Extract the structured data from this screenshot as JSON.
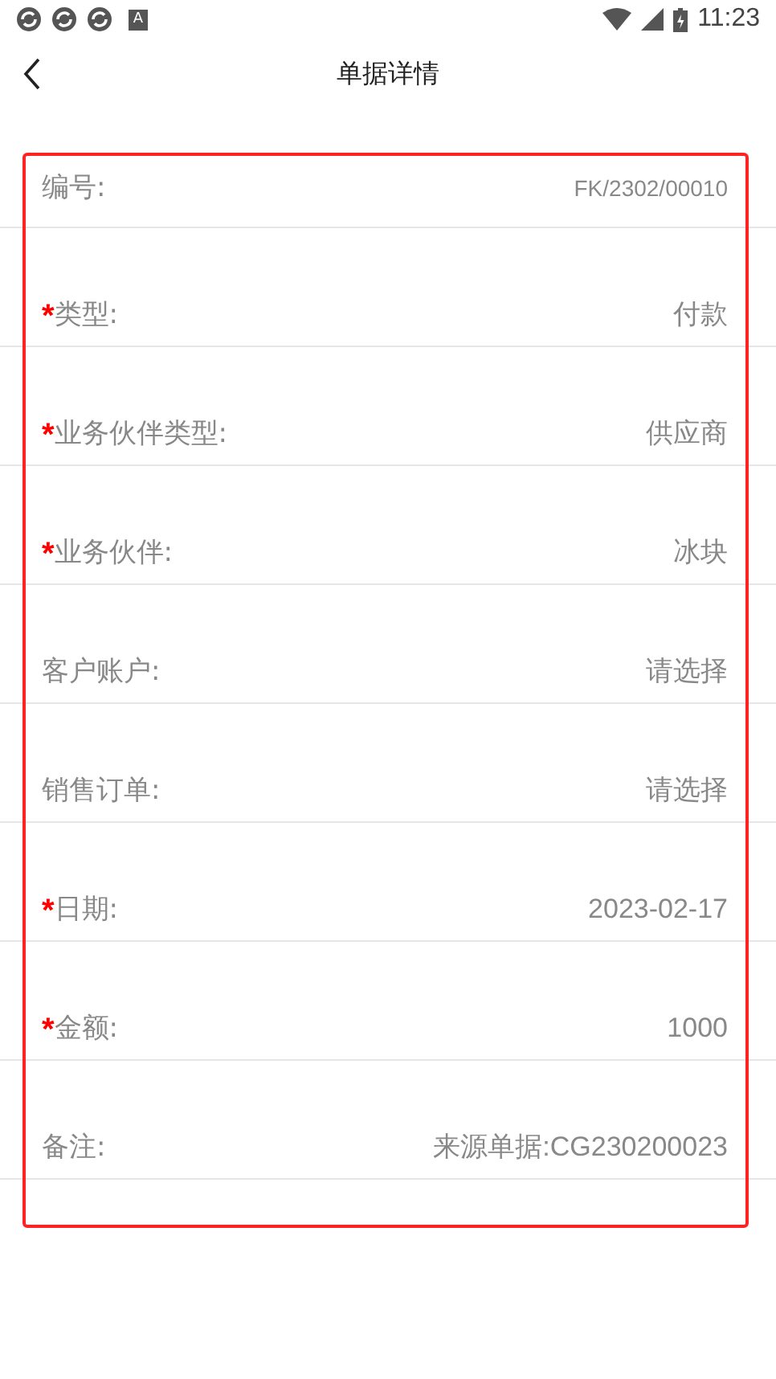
{
  "status_bar": {
    "time": "11:23",
    "notification_badge": "A"
  },
  "header": {
    "title": "单据详情"
  },
  "fields": [
    {
      "label": "编号:",
      "value": "FK/2302/00010",
      "required": false
    },
    {
      "label": "类型:",
      "value": "付款",
      "required": true
    },
    {
      "label": "业务伙伴类型:",
      "value": "供应商",
      "required": true
    },
    {
      "label": "业务伙伴:",
      "value": "冰块",
      "required": true
    },
    {
      "label": "客户账户:",
      "value": "请选择",
      "required": false
    },
    {
      "label": "销售订单:",
      "value": "请选择",
      "required": false
    },
    {
      "label": "日期:",
      "value": "2023-02-17",
      "required": true
    },
    {
      "label": "金额:",
      "value": "1000",
      "required": true
    },
    {
      "label": "备注:",
      "value": "来源单据:CG230200023",
      "required": false
    }
  ],
  "required_mark": "*"
}
